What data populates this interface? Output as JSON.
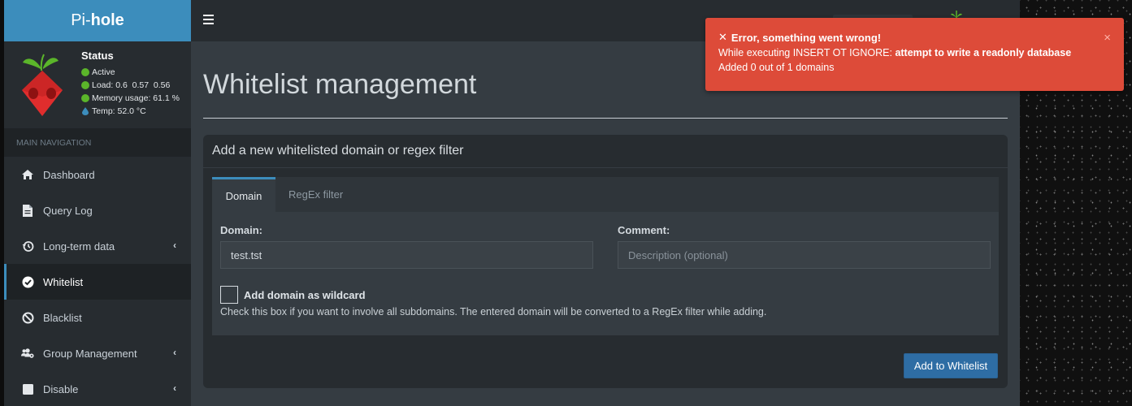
{
  "brand": {
    "prefix": "Pi-",
    "suffix": "hole"
  },
  "status": {
    "title": "Status",
    "state": "Active",
    "load_label": "Load:",
    "load_values": "0.6  0.57  0.56",
    "memory_label": "Memory usage:",
    "memory_value": "61.1 %",
    "temp": "Temp: 52.0 °C"
  },
  "nav": {
    "header": "MAIN NAVIGATION",
    "items": [
      {
        "label": "Dashboard",
        "icon": "home-icon"
      },
      {
        "label": "Query Log",
        "icon": "file-icon"
      },
      {
        "label": "Long-term data",
        "icon": "history-icon",
        "submenu": true
      },
      {
        "label": "Whitelist",
        "icon": "check-circle-icon",
        "active": true
      },
      {
        "label": "Blacklist",
        "icon": "ban-icon"
      },
      {
        "label": "Group Management",
        "icon": "users-cog-icon",
        "submenu": true
      },
      {
        "label": "Disable",
        "icon": "stop-icon",
        "submenu": true
      }
    ]
  },
  "page": {
    "title": "Whitelist management",
    "box_title": "Add a new whitelisted domain or regex filter",
    "tabs": [
      "Domain",
      "RegEx filter"
    ],
    "domain_label": "Domain:",
    "domain_value": "test.tst",
    "comment_label": "Comment:",
    "comment_placeholder": "Description (optional)",
    "wildcard_label": "Add domain as wildcard",
    "wildcard_help": "Check this box if you want to involve all subdomains. The entered domain will be converted to a RegEx filter while adding.",
    "add_button": "Add to Whitelist"
  },
  "toast": {
    "title": "Error, something went wrong!",
    "line1_prefix": "While executing INSERT OT IGNORE: ",
    "line1_bold": "attempt to write a readonly database",
    "line2": "Added 0 out of 1 domains",
    "close": "×"
  },
  "colors": {
    "accent": "#3c8dbc",
    "sidebar": "#272c30",
    "content": "#353c42",
    "error": "#dd4b39",
    "status_green": "#5bb52a"
  }
}
